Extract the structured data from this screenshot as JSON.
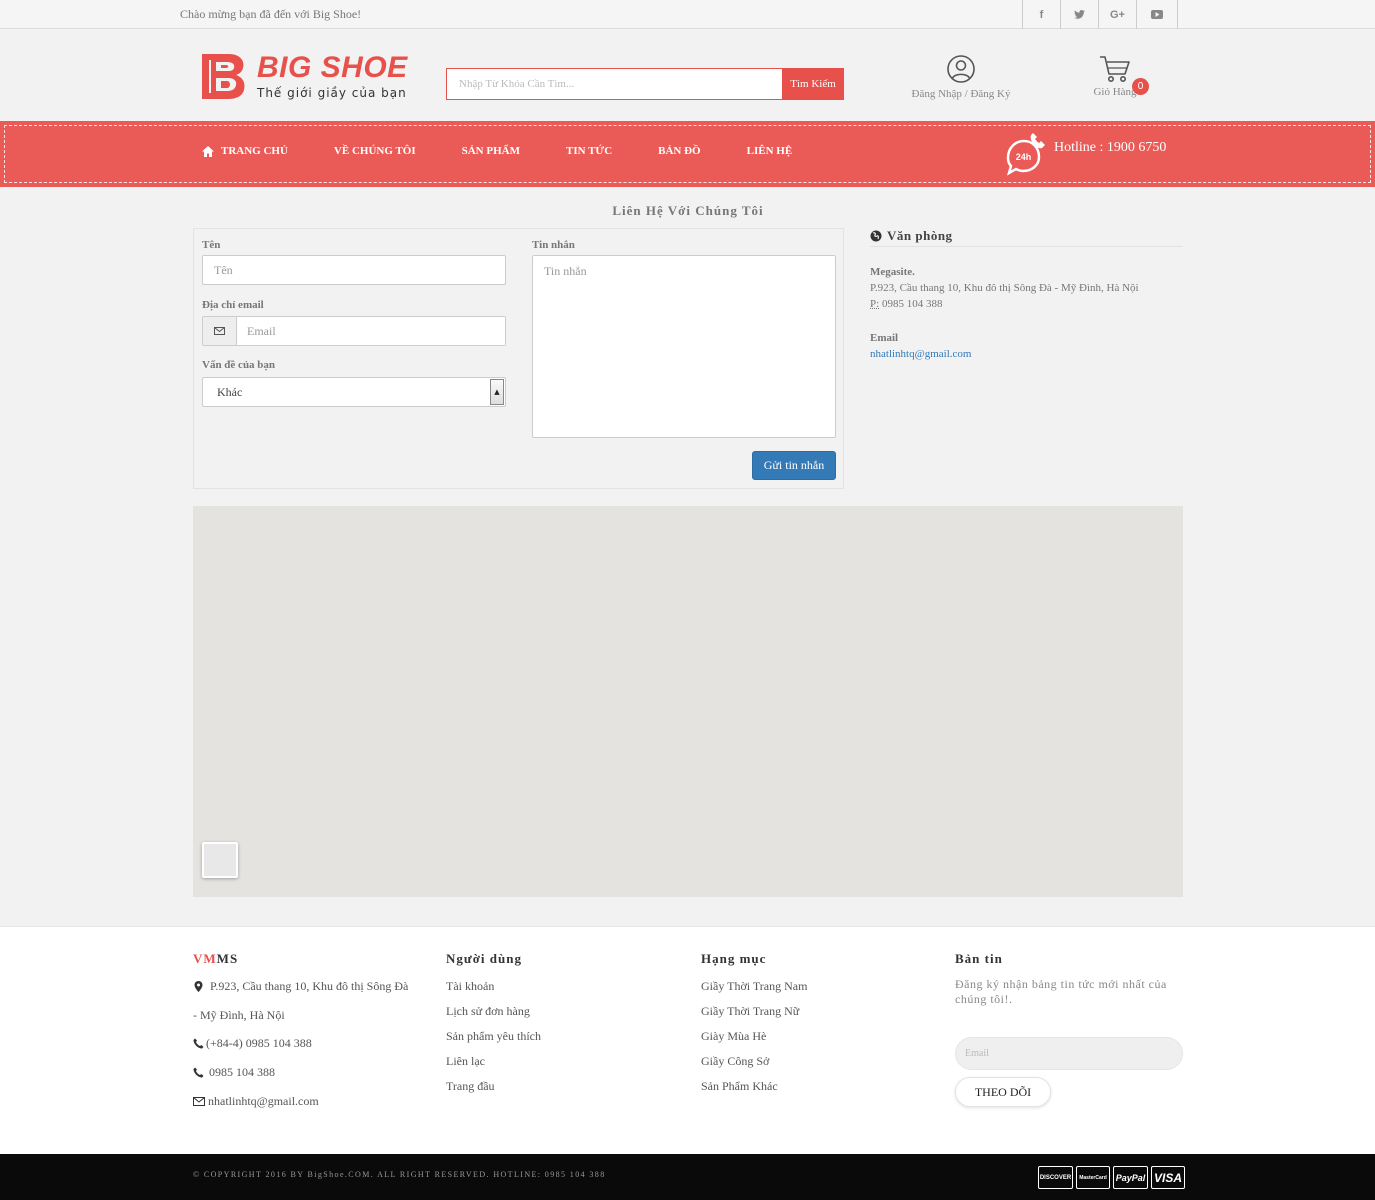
{
  "topbar": {
    "welcome": "Chào mừng bạn đã đến với Big Shoe!",
    "social_icons": [
      "facebook-icon",
      "twitter-icon",
      "google-plus-icon",
      "youtube-icon"
    ]
  },
  "header": {
    "logo_name": "BIG SHOE",
    "logo_tagline": "Thế giới giầy của bạn",
    "search_placeholder": "Nhập Từ Khóa Cần Tìm...",
    "search_button": "Tìm Kiếm",
    "account_label": "Đăng Nhập / Đăng Ký",
    "cart_label": "Giỏ Hàng",
    "cart_count": "0"
  },
  "nav": {
    "items": [
      "Trang chủ",
      "Về chúng tôi",
      "Sản phẩm",
      "Tin tức",
      "Bản đồ",
      "Liên hệ"
    ],
    "hotline": "Hotline : 1900 6750",
    "hotline_badge": "24h"
  },
  "contact": {
    "title": "Liên Hệ Với Chúng Tôi",
    "name_label": "Tên",
    "name_placeholder": "Tên",
    "email_label": "Địa chỉ email",
    "email_placeholder": "Email",
    "topic_label": "Vấn đề của bạn",
    "topic_value": "Khác",
    "message_label": "Tin nhắn",
    "message_placeholder": "Tin nhắn",
    "send_button": "Gửi tin nhắn"
  },
  "office": {
    "title": "Văn phòng",
    "name": "Megasite.",
    "address": "P.923, Cầu thang 10, Khu đô thị Sông Đà - Mỹ Đình, Hà Nội",
    "phone_label": "P:",
    "phone": "0985 104 388",
    "email_label": "Email",
    "email": "nhatlinhtq@gmail.com"
  },
  "footer": {
    "brand_red": "VM",
    "brand_rest": "MS",
    "address_1": "P.923, Cầu thang 10, Khu đô thị Sông Đà",
    "address_2": "- Mỹ Đình, Hà Nội",
    "phone_1": "(+84-4) 0985 104 388",
    "phone_2": "0985 104 388",
    "email": "nhatlinhtq@gmail.com",
    "users_title": "Người dùng",
    "users_links": [
      "Tài khoản",
      "Lịch sử đơn hàng",
      "Sản phẩm yêu thích",
      "Liên lạc",
      "Trang đầu"
    ],
    "categories_title": "Hạng mục",
    "categories_links": [
      "Giầy Thời Trang Nam",
      "Giầy Thời Trang Nữ",
      "Giày Mùa Hè",
      "Giầy Công Sở",
      "Sản Phẩm Khác"
    ],
    "newsletter_title": "Bản tin",
    "newsletter_desc": "Đăng ký nhận bảng tin tức mới nhất của chúng tôi!.",
    "newsletter_placeholder": "Email",
    "newsletter_button": "THEO DÕI",
    "copyright": "© COPYRIGHT 2016 BY BigShoe.COM. ALL RIGHT RESERVED. HOTLINE: 0985 104 388",
    "payments": [
      "DISCOVER",
      "MasterCard",
      "PayPal",
      "VISA"
    ]
  },
  "colors": {
    "brand_red": "#e8514b",
    "nav_red": "#ea5a56",
    "button_blue": "#337ab7",
    "footer_black": "#0a0a0a"
  }
}
